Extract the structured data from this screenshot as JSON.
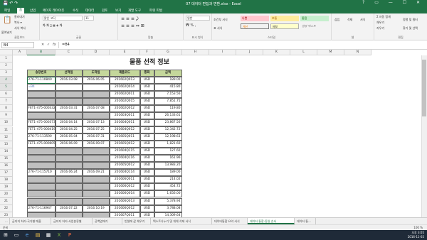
{
  "window": {
    "title": "07 데이터 편집과 변환.xlsx - Excel",
    "qat": "💾 ↶ ↷",
    "controls": "? ▭ — ☐ ✕"
  },
  "ribbon": {
    "tabs": [
      "파일",
      "홈",
      "삽입",
      "페이지 레이아웃",
      "수식",
      "데이터",
      "검토",
      "보기",
      "개발 도구",
      "파워 피벗"
    ],
    "clipboard": {
      "paste": "붙여넣기",
      "cut": "잘라내기",
      "copy": "복사 ▾",
      "format": "서식 복사",
      "group": "클립보드"
    },
    "font": {
      "name": "맑은 고딕",
      "size": "11",
      "group": "글꼴"
    },
    "alignment": {
      "group": "맞춤"
    },
    "number": {
      "format": "일반",
      "group": "표시 형식"
    },
    "styles": {
      "items": [
        "나쁨",
        "보통",
        "좋음",
        "계산",
        "메모",
        "설명 텍스트"
      ],
      "cond": "조건부 서식",
      "table": "표 서식",
      "group": "스타일"
    },
    "cells": {
      "insert": "삽입",
      "delete": "삭제",
      "format": "서식",
      "group": "셀"
    },
    "editing": {
      "sum": "Σ 자동 합계",
      "fill": "채우기",
      "clear": "지우기",
      "sort": "정렬 및 필터",
      "find": "찾기 및 선택",
      "group": "편집"
    }
  },
  "formula_bar": {
    "name_box": "B4",
    "cancel": "✕",
    "enter": "✓",
    "fx": "fx",
    "value": "=B4"
  },
  "sheet": {
    "title": "물품 선적 정보",
    "col_headers": [
      "A",
      "B",
      "C",
      "D",
      "E",
      "F",
      "G",
      "H",
      "I",
      "J",
      "K",
      "L",
      "M",
      "N"
    ],
    "headers": [
      "송장번호",
      "선적일",
      "도착일",
      "제품코드",
      "통화",
      "금액"
    ],
    "rows": [
      {
        "n": "3",
        "v": [
          "",
          "",
          "",
          "",
          "",
          ""
        ],
        "gray": false,
        "hd": true
      },
      {
        "n": "4",
        "v": [
          "276-71-110840",
          "2016.03.08",
          "2016.06.05",
          "201602Q013",
          "USD",
          "189.00"
        ],
        "gray": false
      },
      {
        "n": "5",
        "v": [
          "=B4",
          "",
          "",
          "201602Q014",
          "USD",
          "415.80"
        ],
        "gray": false
      },
      {
        "n": "6",
        "v": [
          "",
          "",
          "",
          "201602Q011",
          "USD",
          "7,153.56"
        ],
        "gray": true
      },
      {
        "n": "7",
        "v": [
          "",
          "",
          "",
          "201602Q015",
          "USD",
          "7,851.75"
        ],
        "gray": true
      },
      {
        "n": "8",
        "v": [
          "FET1-475-000332",
          "2016.03.31",
          "2016.07.08",
          "201602Q012",
          "USD",
          "119.80"
        ],
        "gray": false
      },
      {
        "n": "9",
        "v": [
          "",
          "",
          "",
          "201603Q011",
          "USD",
          "26,133.61"
        ],
        "gray": true
      },
      {
        "n": "10",
        "v": [
          "FET1-475-000373",
          "2016.04.14",
          "2016.07.13",
          "201604Q011",
          "USD",
          "23,867.56"
        ],
        "gray": false
      },
      {
        "n": "11",
        "v": [
          "FET1-475-000419",
          "2016.04.25",
          "2016.07.25",
          "201604Q012",
          "USD",
          "12,342.72"
        ],
        "gray": false
      },
      {
        "n": "12",
        "v": [
          "276-71-113590",
          "2016.05.04",
          "2016.07.31",
          "201605Q011",
          "USD",
          "12,198.63"
        ],
        "gray": false
      },
      {
        "n": "13",
        "v": [
          "FET1-475-000605",
          "2016.06.09",
          "2016.09.07",
          "201605Q012",
          "USD",
          "1,821.60"
        ],
        "gray": false
      },
      {
        "n": "14",
        "v": [
          "",
          "",
          "",
          "201604Q115",
          "USD",
          "127.60"
        ],
        "gray": true
      },
      {
        "n": "15",
        "v": [
          "",
          "",
          "",
          "201604Q116",
          "USD",
          "161.96"
        ],
        "gray": true
      },
      {
        "n": "16",
        "v": [
          "",
          "",
          "",
          "201605Q012",
          "USD",
          "13,983.20"
        ],
        "gray": true
      },
      {
        "n": "17",
        "v": [
          "276-71-115710",
          "2016.06.24",
          "2016.09.21",
          "201604Q114",
          "USD",
          "189.00"
        ],
        "gray": false
      },
      {
        "n": "18",
        "v": [
          "",
          "",
          "",
          "201606Q011",
          "USD",
          "214.02"
        ],
        "gray": true
      },
      {
        "n": "19",
        "v": [
          "",
          "",
          "",
          "201606Q012",
          "USD",
          "454.72"
        ],
        "gray": true
      },
      {
        "n": "20",
        "v": [
          "",
          "",
          "",
          "201606Q014",
          "USD",
          "1,656.00"
        ],
        "gray": true
      },
      {
        "n": "21",
        "v": [
          "",
          "",
          "",
          "201606Q013",
          "USD",
          "5,378.94"
        ],
        "gray": true
      },
      {
        "n": "22",
        "v": [
          "276-71-116947",
          "2016.07.22",
          "2016.10.19",
          "201606Q012",
          "USD",
          "3,788.08"
        ],
        "gray": false
      },
      {
        "n": "23",
        "v": [
          "",
          "",
          "",
          "201607Q011",
          "USD",
          "14,309.64"
        ],
        "gray": true
      },
      {
        "n": "24",
        "v": [
          "FET1-475-000870",
          "2016.08.12",
          "2016.11.10",
          "201607Q012",
          "USD",
          "3,343.52"
        ],
        "gray": false
      }
    ]
  },
  "sheet_tabs": [
    "...",
    "금지지 처리-국가별 매출",
    "금지지 처리-사업분류별",
    "공백없애기",
    "빈셀에 값 채우기",
    "텍스트나누기 및 개체 삭제 서식",
    "데이터통합 요약 서식",
    "데이터 통합-동일 순서",
    "데이터 통..."
  ],
  "active_tab": 7,
  "status": {
    "left": "준비",
    "zoom": "100 %"
  },
  "taskbar": {
    "time": "오후 3:05",
    "date": "2016-11-02"
  }
}
